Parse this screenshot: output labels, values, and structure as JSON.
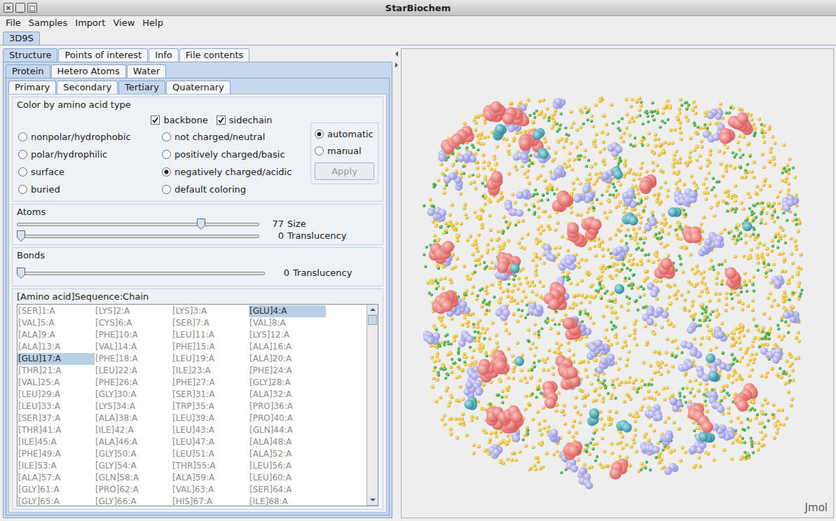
{
  "window": {
    "title": "StarBiochem",
    "controls": [
      "✕",
      "_",
      "□"
    ]
  },
  "menu": [
    "File",
    "Samples",
    "Import",
    "View",
    "Help"
  ],
  "documents": [
    {
      "label": "3D9S",
      "selected": true
    }
  ],
  "tabs": [
    {
      "label": "Structure",
      "selected": true
    },
    {
      "label": "Points of interest",
      "selected": false
    },
    {
      "label": "Info",
      "selected": false
    },
    {
      "label": "File contents",
      "selected": false
    }
  ],
  "subtabs": [
    {
      "label": "Protein",
      "selected": true
    },
    {
      "label": "Hetero Atoms",
      "selected": false
    },
    {
      "label": "Water",
      "selected": false
    }
  ],
  "view_tabs": [
    {
      "label": "Primary",
      "selected": false
    },
    {
      "label": "Secondary",
      "selected": false
    },
    {
      "label": "Tertiary",
      "selected": true
    },
    {
      "label": "Quaternary",
      "selected": false
    }
  ],
  "color_group": {
    "title": "Color by amino acid type",
    "checkboxes": [
      {
        "label": "backbone",
        "checked": true
      },
      {
        "label": "sidechain",
        "checked": true
      }
    ],
    "radios": [
      {
        "label": "nonpolar/hydrophobic",
        "selected": false
      },
      {
        "label": "polar/hydrophilic",
        "selected": false
      },
      {
        "label": "surface",
        "selected": false
      },
      {
        "label": "buried",
        "selected": false
      },
      {
        "label": "not charged/neutral",
        "selected": false
      },
      {
        "label": "positively charged/basic",
        "selected": false
      },
      {
        "label": "negatively charged/acidic",
        "selected": true
      },
      {
        "label": "default coloring",
        "selected": false
      }
    ],
    "modes": [
      {
        "label": "automatic",
        "selected": true
      },
      {
        "label": "manual",
        "selected": false
      }
    ],
    "apply": {
      "label": "Apply",
      "disabled": true
    }
  },
  "atoms": {
    "title": "Atoms",
    "sliders": [
      {
        "label": "Size",
        "reading": "77",
        "level": 0.77
      },
      {
        "label": "Translucency",
        "reading": "0",
        "level": 0
      }
    ]
  },
  "bonds": {
    "title": "Bonds",
    "sliders": [
      {
        "label": "Translucency",
        "reading": "0",
        "level": 0
      }
    ]
  },
  "sequence": {
    "title": "[Amino acid]Sequence:Chain",
    "scroll_level": 0,
    "items": [
      {
        "label": "[SER]1:A",
        "selected": false
      },
      {
        "label": "[LYS]2:A",
        "selected": false
      },
      {
        "label": "[LYS]3:A",
        "selected": false
      },
      {
        "label": "[GLU]4:A",
        "selected": true
      },
      {
        "label": "[VAL]5:A",
        "selected": false
      },
      {
        "label": "[CYS]6:A",
        "selected": false
      },
      {
        "label": "[SER]7:A",
        "selected": false
      },
      {
        "label": "[VAL]8:A",
        "selected": false
      },
      {
        "label": "[ALA]9:A",
        "selected": false
      },
      {
        "label": "[PHE]10:A",
        "selected": false
      },
      {
        "label": "[LEU]11:A",
        "selected": false
      },
      {
        "label": "[LYS]12:A",
        "selected": false
      },
      {
        "label": "[ALA]13:A",
        "selected": false
      },
      {
        "label": "[VAL]14:A",
        "selected": false
      },
      {
        "label": "[PHE]15:A",
        "selected": false
      },
      {
        "label": "[ALA]16:A",
        "selected": false
      },
      {
        "label": "[GLU]17:A",
        "selected": true
      },
      {
        "label": "[PHE]18:A",
        "selected": false
      },
      {
        "label": "[LEU]19:A",
        "selected": false
      },
      {
        "label": "[ALA]20:A",
        "selected": false
      },
      {
        "label": "[THR]21:A",
        "selected": false
      },
      {
        "label": "[LEU]22:A",
        "selected": false
      },
      {
        "label": "[ILE]23:A",
        "selected": false
      },
      {
        "label": "[PHE]24:A",
        "selected": false
      },
      {
        "label": "[VAL]25:A",
        "selected": false
      },
      {
        "label": "[PHE]26:A",
        "selected": false
      },
      {
        "label": "[PHE]27:A",
        "selected": false
      },
      {
        "label": "[GLY]28:A",
        "selected": false
      },
      {
        "label": "[LEU]29:A",
        "selected": false
      },
      {
        "label": "[GLY]30:A",
        "selected": false
      },
      {
        "label": "[SER]31:A",
        "selected": false
      },
      {
        "label": "[ALA]32:A",
        "selected": false
      },
      {
        "label": "[LEU]33:A",
        "selected": false
      },
      {
        "label": "[LYS]34:A",
        "selected": false
      },
      {
        "label": "[TRP]35:A",
        "selected": false
      },
      {
        "label": "[PRO]36:A",
        "selected": false
      },
      {
        "label": "[SER]37:A",
        "selected": false
      },
      {
        "label": "[ALA]38:A",
        "selected": false
      },
      {
        "label": "[LEU]39:A",
        "selected": false
      },
      {
        "label": "[PRO]40:A",
        "selected": false
      },
      {
        "label": "[THR]41:A",
        "selected": false
      },
      {
        "label": "[ILE]42:A",
        "selected": false
      },
      {
        "label": "[LEU]43:A",
        "selected": false
      },
      {
        "label": "[GLN]44:A",
        "selected": false
      },
      {
        "label": "[ILE]45:A",
        "selected": false
      },
      {
        "label": "[ALA]46:A",
        "selected": false
      },
      {
        "label": "[LEU]47:A",
        "selected": false
      },
      {
        "label": "[ALA]48:A",
        "selected": false
      },
      {
        "label": "[PHE]49:A",
        "selected": false
      },
      {
        "label": "[GLY]50:A",
        "selected": false
      },
      {
        "label": "[LEU]51:A",
        "selected": false
      },
      {
        "label": "[ALA]52:A",
        "selected": false
      },
      {
        "label": "[ILE]53:A",
        "selected": false
      },
      {
        "label": "[GLY]54:A",
        "selected": false
      },
      {
        "label": "[THR]55:A",
        "selected": false
      },
      {
        "label": "[LEU]56:A",
        "selected": false
      },
      {
        "label": "[ALA]57:A",
        "selected": false
      },
      {
        "label": "[GLN]58:A",
        "selected": false
      },
      {
        "label": "[ALA]59:A",
        "selected": false
      },
      {
        "label": "[LEU]60:A",
        "selected": false
      },
      {
        "label": "[GLY]61:A",
        "selected": false
      },
      {
        "label": "[PRO]62:A",
        "selected": false
      },
      {
        "label": "[VAL]63:A",
        "selected": false
      },
      {
        "label": "[SER]64:A",
        "selected": false
      },
      {
        "label": "[GLY]65:A",
        "selected": false
      },
      {
        "label": "[GLY]66:A",
        "selected": false
      },
      {
        "label": "[HIS]67:A",
        "selected": false
      },
      {
        "label": "[ILE]68:A",
        "selected": false
      }
    ]
  },
  "viewer": {
    "watermark": "Jmol"
  }
}
